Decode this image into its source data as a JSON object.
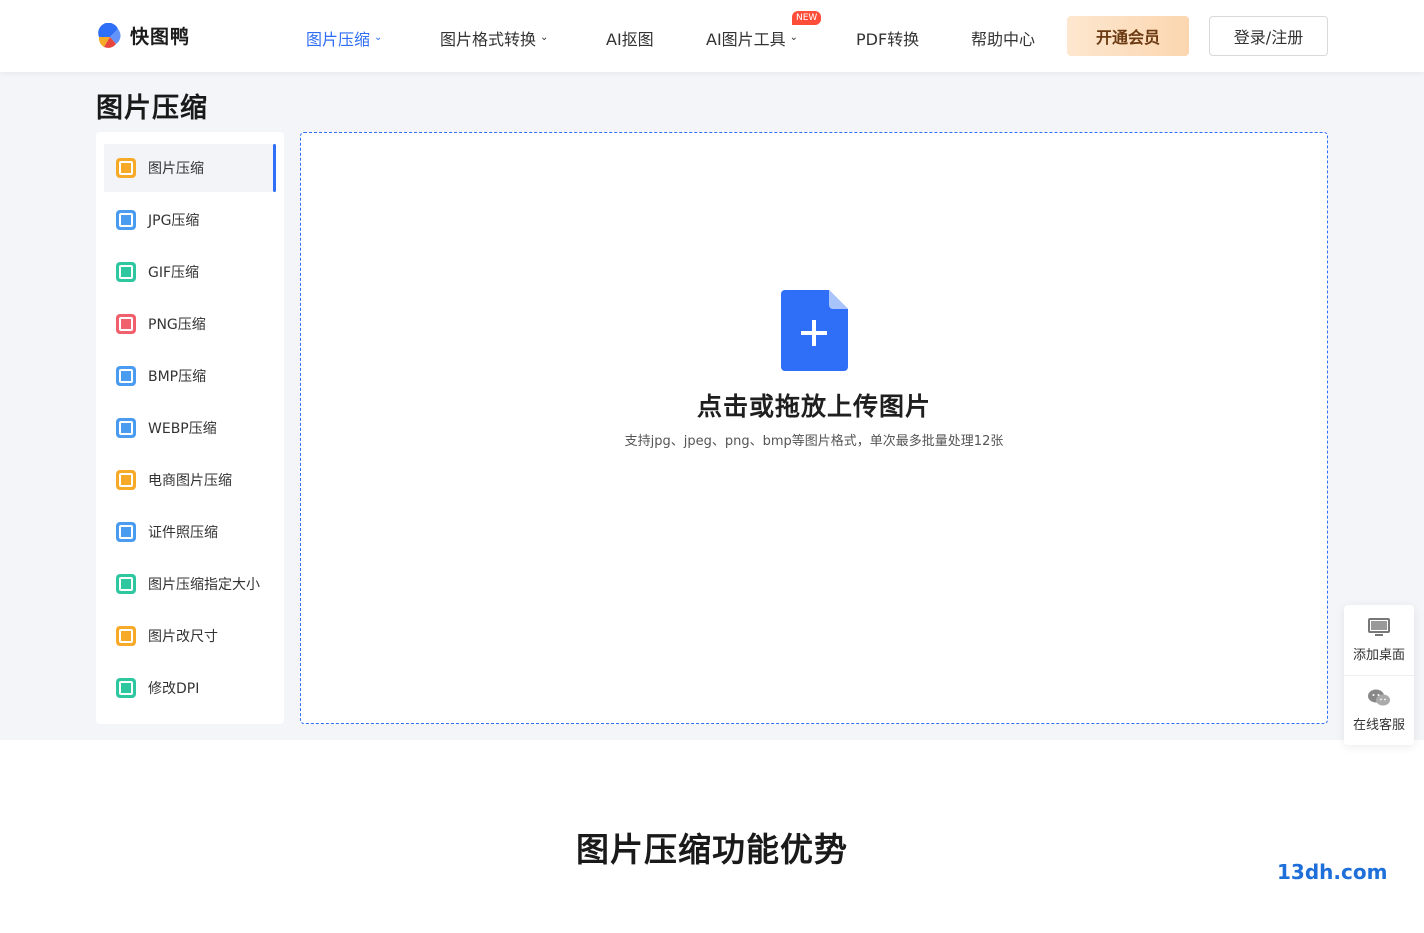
{
  "brand": {
    "name": "快图鸭"
  },
  "nav": {
    "items": [
      {
        "label": "图片压缩",
        "dropdown": true,
        "active": true
      },
      {
        "label": "图片格式转换",
        "dropdown": true
      },
      {
        "label": "AI抠图"
      },
      {
        "label": "AI图片工具",
        "dropdown": true,
        "badge": "NEW"
      },
      {
        "label": "PDF转换"
      },
      {
        "label": "帮助中心"
      }
    ],
    "vip_label": "开通会员",
    "login_label": "登录/注册"
  },
  "page": {
    "title": "图片压缩"
  },
  "sidebar": {
    "items": [
      {
        "label": "图片压缩",
        "color": "#f7a928",
        "active": true
      },
      {
        "label": "JPG压缩",
        "color": "#4a9cf0"
      },
      {
        "label": "GIF压缩",
        "color": "#2fc7a0"
      },
      {
        "label": "PNG压缩",
        "color": "#f0616d"
      },
      {
        "label": "BMP压缩",
        "color": "#4a9cf0"
      },
      {
        "label": "WEBP压缩",
        "color": "#4a9cf0"
      },
      {
        "label": "电商图片压缩",
        "color": "#f7a928"
      },
      {
        "label": "证件照压缩",
        "color": "#4a9cf0"
      },
      {
        "label": "图片压缩指定大小",
        "color": "#2fc7a0"
      },
      {
        "label": "图片改尺寸",
        "color": "#f7a928"
      },
      {
        "label": "修改DPI",
        "color": "#2fc7a0"
      }
    ]
  },
  "upload": {
    "title": "点击或拖放上传图片",
    "subtitle": "支持jpg、jpeg、png、bmp等图片格式，单次最多批量处理12张",
    "accent": "#2f6ef6"
  },
  "float_panel": {
    "items": [
      {
        "label": "添加桌面",
        "icon": "monitor-icon"
      },
      {
        "label": "在线客服",
        "icon": "wechat-icon"
      }
    ]
  },
  "section": {
    "title": "图片压缩功能优势"
  },
  "watermark": "13dh.com"
}
